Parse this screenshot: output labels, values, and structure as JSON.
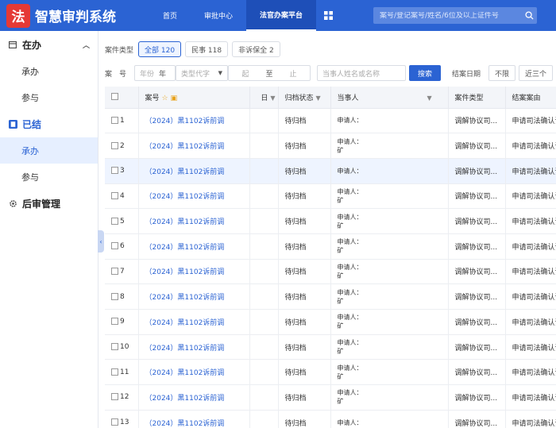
{
  "header": {
    "logo_char": "法",
    "app_title": "智慧审判系统",
    "nav": [
      {
        "label": "首页",
        "active": false
      },
      {
        "label": "审批中心",
        "active": false
      },
      {
        "label": "法官办案平台",
        "active": true
      }
    ],
    "grid_icon": "grid-icon",
    "search_placeholder": "案号/登记案号/姓名/6位及以上证件号",
    "search_icon": "search-icon"
  },
  "sidebar": {
    "groups": [
      {
        "label": "在办",
        "icon": "calendar-icon",
        "expanded": true,
        "items": [
          {
            "label": "承办",
            "active": false
          },
          {
            "label": "参与",
            "active": false
          }
        ]
      },
      {
        "label": "已结",
        "icon": "badge-icon",
        "expanded": true,
        "active": true,
        "items": [
          {
            "label": "承办",
            "active": true
          },
          {
            "label": "参与",
            "active": false
          }
        ]
      },
      {
        "label": "后审管理",
        "icon": "gear-icon",
        "expanded": false,
        "items": []
      }
    ],
    "collapse_glyph": "‹"
  },
  "filters": {
    "case_type_label": "案件类型",
    "case_type_chips": [
      {
        "label": "全部 120",
        "active": true
      },
      {
        "label": "民事 118",
        "active": false
      },
      {
        "label": "非诉保全 2",
        "active": false
      }
    ],
    "case_no_label": "案　号",
    "year_placeholder": "年份",
    "year_suffix": "年",
    "type_code_placeholder": "类型代字",
    "start_label": "起",
    "to_label": "至",
    "end_label": "止",
    "party_placeholder": "当事人姓名或名称",
    "search_button": "搜索",
    "close_date_label": "结案日期",
    "unlimited": "不限",
    "last_three": "近三个"
  },
  "table": {
    "columns": [
      "",
      "案号",
      "日",
      "归档状态",
      "当事人",
      "案件类型",
      "结案案由"
    ],
    "rows": [
      {
        "n": "1",
        "case": "（2024）黑1102诉前调",
        "status": "待归档",
        "party": "申请人：",
        "type": "调解协议司...",
        "reason": "申请司法确认调"
      },
      {
        "n": "2",
        "case": "（2024）黑1102诉前调",
        "status": "待归档",
        "party": "申请人：",
        "party2": "矿",
        "type": "调解协议司...",
        "reason": "申请司法确认调"
      },
      {
        "n": "3",
        "case": "（2024）黑1102诉前调",
        "status": "待归档",
        "party": "申请人：",
        "type": "调解协议司...",
        "reason": "申请司法确认调"
      },
      {
        "n": "4",
        "case": "（2024）黑1102诉前调",
        "status": "待归档",
        "party": "申请人：",
        "party2": "矿",
        "type": "调解协议司...",
        "reason": "申请司法确认调"
      },
      {
        "n": "5",
        "case": "（2024）黑1102诉前调",
        "status": "待归档",
        "party": "申请人：",
        "party2": "矿",
        "type": "调解协议司...",
        "reason": "申请司法确认调"
      },
      {
        "n": "6",
        "case": "（2024）黑1102诉前调",
        "status": "待归档",
        "party": "申请人：",
        "party2": "矿",
        "type": "调解协议司...",
        "reason": "申请司法确认调"
      },
      {
        "n": "7",
        "case": "（2024）黑1102诉前调",
        "status": "待归档",
        "party": "申请人：",
        "party2": "矿",
        "type": "调解协议司...",
        "reason": "申请司法确认调"
      },
      {
        "n": "8",
        "case": "（2024）黑1102诉前调",
        "status": "待归档",
        "party": "申请人：",
        "party2": "矿",
        "type": "调解协议司...",
        "reason": "申请司法确认调"
      },
      {
        "n": "9",
        "case": "（2024）黑1102诉前调",
        "status": "待归档",
        "party": "申请人：",
        "party2": "矿",
        "type": "调解协议司...",
        "reason": "申请司法确认调"
      },
      {
        "n": "10",
        "case": "（2024）黑1102诉前调",
        "status": "待归档",
        "party": "申请人：",
        "party2": "矿",
        "type": "调解协议司...",
        "reason": "申请司法确认调"
      },
      {
        "n": "11",
        "case": "（2024）黑1102诉前调",
        "status": "待归档",
        "party": "申请人：",
        "party2": "矿",
        "type": "调解协议司...",
        "reason": "申请司法确认调"
      },
      {
        "n": "12",
        "case": "（2024）黑1102诉前调",
        "status": "待归档",
        "party": "申请人：",
        "party2": "矿",
        "type": "调解协议司...",
        "reason": "申请司法确认调"
      },
      {
        "n": "13",
        "case": "（2024）黑1102诉前调",
        "status": "待归档",
        "party": "申请人：",
        "type": "调解协议司...",
        "reason": "申请司法确认调"
      }
    ],
    "selected_row": 3
  }
}
